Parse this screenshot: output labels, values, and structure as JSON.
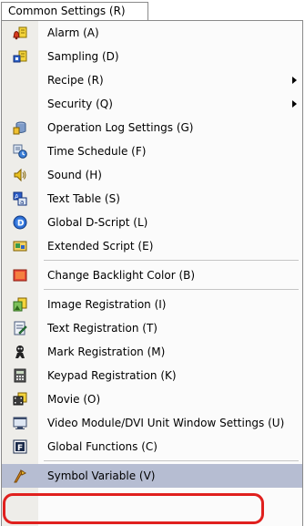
{
  "menu": {
    "title": "Common Settings (R)",
    "items": [
      {
        "label": "Alarm (A)",
        "icon": "alarm-bell-icon",
        "submenu": false
      },
      {
        "label": "Sampling (D)",
        "icon": "sampling-icon",
        "submenu": false
      },
      {
        "label": "Recipe (R)",
        "icon": "",
        "submenu": true
      },
      {
        "label": "Security (Q)",
        "icon": "",
        "submenu": true
      },
      {
        "label": "Operation Log Settings (G)",
        "icon": "operation-log-icon",
        "submenu": false
      },
      {
        "label": "Time Schedule (F)",
        "icon": "time-schedule-icon",
        "submenu": false
      },
      {
        "label": "Sound (H)",
        "icon": "sound-speaker-icon",
        "submenu": false
      },
      {
        "label": "Text Table (S)",
        "icon": "text-table-icon",
        "submenu": false
      },
      {
        "label": "Global D-Script (L)",
        "icon": "global-dscript-icon",
        "submenu": false
      },
      {
        "label": "Extended Script (E)",
        "icon": "extended-script-icon",
        "submenu": false
      },
      {
        "label": "Change Backlight Color (B)",
        "icon": "backlight-color-icon",
        "submenu": false
      },
      {
        "label": "Image Registration (I)",
        "icon": "image-registration-icon",
        "submenu": false
      },
      {
        "label": "Text Registration (T)",
        "icon": "text-registration-icon",
        "submenu": false
      },
      {
        "label": "Mark Registration (M)",
        "icon": "mark-registration-icon",
        "submenu": false
      },
      {
        "label": "Keypad Registration (K)",
        "icon": "keypad-registration-icon",
        "submenu": false
      },
      {
        "label": "Movie (O)",
        "icon": "movie-icon",
        "submenu": false
      },
      {
        "label": "Video Module/DVI Unit Window Settings (U)",
        "icon": "video-window-icon",
        "submenu": false
      },
      {
        "label": "Global Functions (C)",
        "icon": "global-functions-icon",
        "submenu": false
      },
      {
        "label": "Symbol Variable (V)",
        "icon": "symbol-variable-icon",
        "submenu": false,
        "selected": true
      }
    ]
  },
  "colors": {
    "highlight_border": "#e0201e",
    "selected_background": "#b6bdd2",
    "icon_gutter": "#eeede9"
  }
}
